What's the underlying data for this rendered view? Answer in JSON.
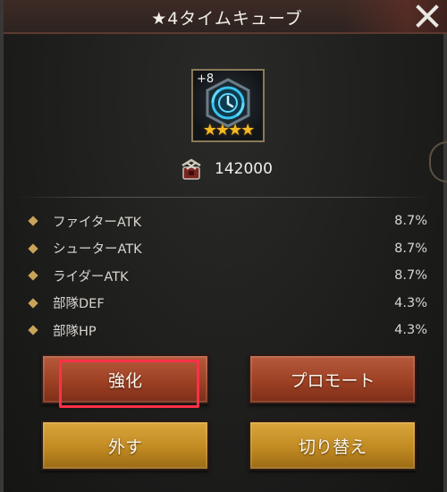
{
  "window": {
    "title": "★4タイムキューブ",
    "close_icon": "close-icon"
  },
  "item": {
    "level": "+8",
    "stars": "★★★★",
    "star_count": 4,
    "icon": "time-cube-icon"
  },
  "cost": {
    "icon": "supply-crate-icon",
    "value": "142000"
  },
  "stats": [
    {
      "label": "ファイターATK",
      "value": "8.7%"
    },
    {
      "label": "シューターATK",
      "value": "8.7%"
    },
    {
      "label": "ライダーATK",
      "value": "8.7%"
    },
    {
      "label": "部隊DEF",
      "value": "4.3%"
    },
    {
      "label": "部隊HP",
      "value": "4.3%"
    }
  ],
  "buttons": {
    "enhance": "強化",
    "promote": "プロモート",
    "unequip": "外す",
    "switch": "切り替え"
  },
  "colors": {
    "button_red": "#9d4024",
    "button_gold": "#c18a22",
    "highlight": "#ff3048",
    "star": "#f4b923"
  }
}
